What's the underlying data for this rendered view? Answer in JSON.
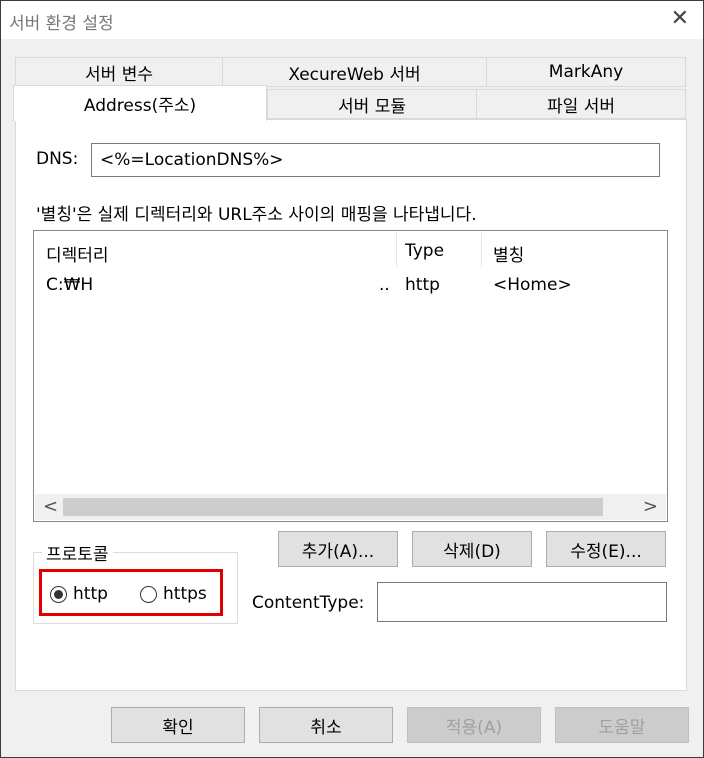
{
  "window": {
    "title": "서버 환경 설정",
    "close": "✕"
  },
  "tabs_row1": [
    "서버 변수",
    "XecureWeb 서버",
    "MarkAny"
  ],
  "tabs_row2": [
    "Address(주소)",
    "서버 모듈",
    "파일 서버"
  ],
  "dns": {
    "label": "DNS:",
    "value": "<%=LocationDNS%>"
  },
  "description": "'별칭'은 실제 디렉터리와 URL주소 사이의 매핑을 나타냅니다.",
  "table": {
    "columns": [
      "디렉터리",
      "Type",
      "별칭"
    ],
    "rows": [
      {
        "dir": "C:₩H",
        "ellipsis": "..",
        "type": "http",
        "alias": "<Home>"
      }
    ]
  },
  "scrollbar": {
    "left_arrow": "<",
    "right_arrow": ">"
  },
  "list_buttons": {
    "add": "추가(A)...",
    "delete": "삭제(D)",
    "edit": "수정(E)..."
  },
  "protocol": {
    "label": "프로토콜",
    "options": [
      "http",
      "https"
    ],
    "selected": "http"
  },
  "content_type": {
    "label": "ContentType:",
    "value": ""
  },
  "footer": {
    "ok": "확인",
    "cancel": "취소",
    "apply": "적용(A)",
    "help": "도움말"
  }
}
